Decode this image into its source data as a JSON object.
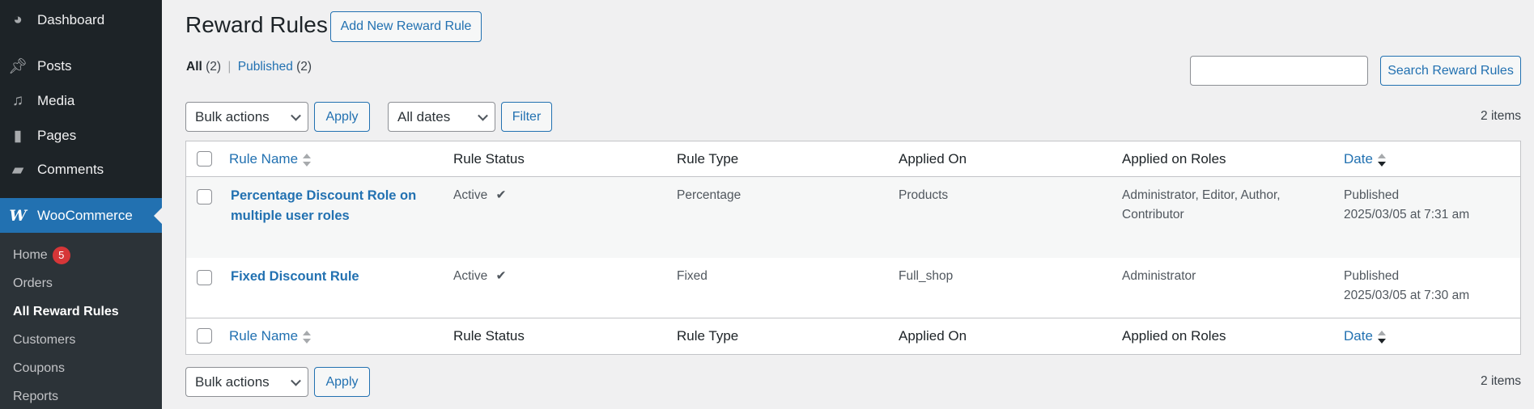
{
  "sidebar": {
    "items": [
      {
        "label": "Dashboard",
        "icon": "dashboard-icon"
      },
      {
        "label": "Posts",
        "icon": "pin-icon"
      },
      {
        "label": "Media",
        "icon": "media-icon"
      },
      {
        "label": "Pages",
        "icon": "pages-icon"
      },
      {
        "label": "Comments",
        "icon": "comment-icon"
      },
      {
        "label": "WooCommerce",
        "icon": "woocommerce-icon"
      }
    ],
    "submenu": [
      {
        "label": "Home",
        "badge": "5"
      },
      {
        "label": "Orders"
      },
      {
        "label": "All Reward Rules"
      },
      {
        "label": "Customers"
      },
      {
        "label": "Coupons"
      },
      {
        "label": "Reports"
      }
    ]
  },
  "page": {
    "title": "Reward Rules",
    "add_new": "Add New Reward Rule",
    "views": {
      "all": "All",
      "all_count": "(2)",
      "sep": "|",
      "published": "Published",
      "published_count": "(2)"
    },
    "search": {
      "value": "",
      "button": "Search Reward Rules"
    },
    "bulk_actions": "Bulk actions",
    "apply": "Apply",
    "dates": "All dates",
    "filter": "Filter",
    "items_count": "2 items"
  },
  "table": {
    "columns": [
      "Rule Name",
      "Rule Status",
      "Rule Type",
      "Applied On",
      "Applied on Roles",
      "Date"
    ],
    "rows": [
      {
        "name": "Percentage Discount Role on multiple user roles",
        "status": "Active",
        "check": "✔",
        "type": "Percentage",
        "applied_on": "Products",
        "roles": "Administrator, Editor, Author, Contributor",
        "date_status": "Published",
        "date": "2025/03/05 at 7:31 am"
      },
      {
        "name": "Fixed Discount Rule",
        "status": "Active",
        "check": "✔",
        "type": "Fixed",
        "applied_on": "Full_shop",
        "roles": "Administrator",
        "date_status": "Published",
        "date": "2025/03/05 at 7:30 am"
      }
    ]
  },
  "colors": {
    "accent": "#2271b1",
    "sidebar": "#1d2327",
    "badge": "#d63638"
  }
}
